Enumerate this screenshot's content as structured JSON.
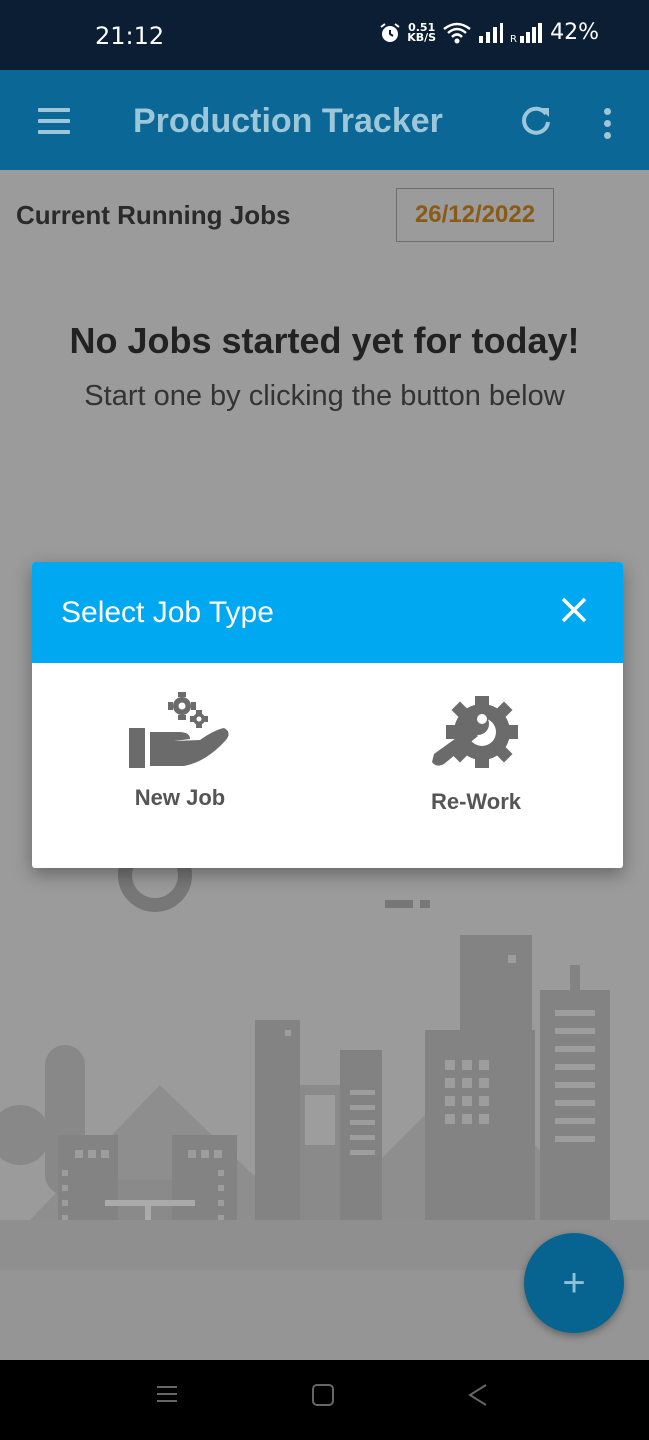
{
  "status_bar": {
    "time": "21:12",
    "net_speed_value": "0.51",
    "net_speed_unit": "KB/S",
    "battery": "42%",
    "icons": [
      "alarm-icon",
      "wifi-icon",
      "signal-icon",
      "signal-roaming-icon"
    ]
  },
  "app_bar": {
    "title": "Production Tracker",
    "menu_icon": "hamburger-menu-icon",
    "refresh_icon": "refresh-icon",
    "more_icon": "more-vertical-icon"
  },
  "content": {
    "section_title": "Current Running Jobs",
    "date": "26/12/2022",
    "empty_title": "No Jobs started yet for today!",
    "empty_subtitle": "Start one by clicking the button below"
  },
  "dialog": {
    "title": "Select Job Type",
    "options": [
      {
        "label": "New Job",
        "icon": "hand-gears-icon"
      },
      {
        "label": "Re-Work",
        "icon": "wrench-gear-icon"
      }
    ]
  },
  "fab": {
    "label": "+"
  },
  "colors": {
    "status_bar": "#0c1e33",
    "app_bar": "#0a6796",
    "dialog_header": "#00a8f2",
    "date_text": "#8a5a18",
    "fab": "#07638f"
  }
}
